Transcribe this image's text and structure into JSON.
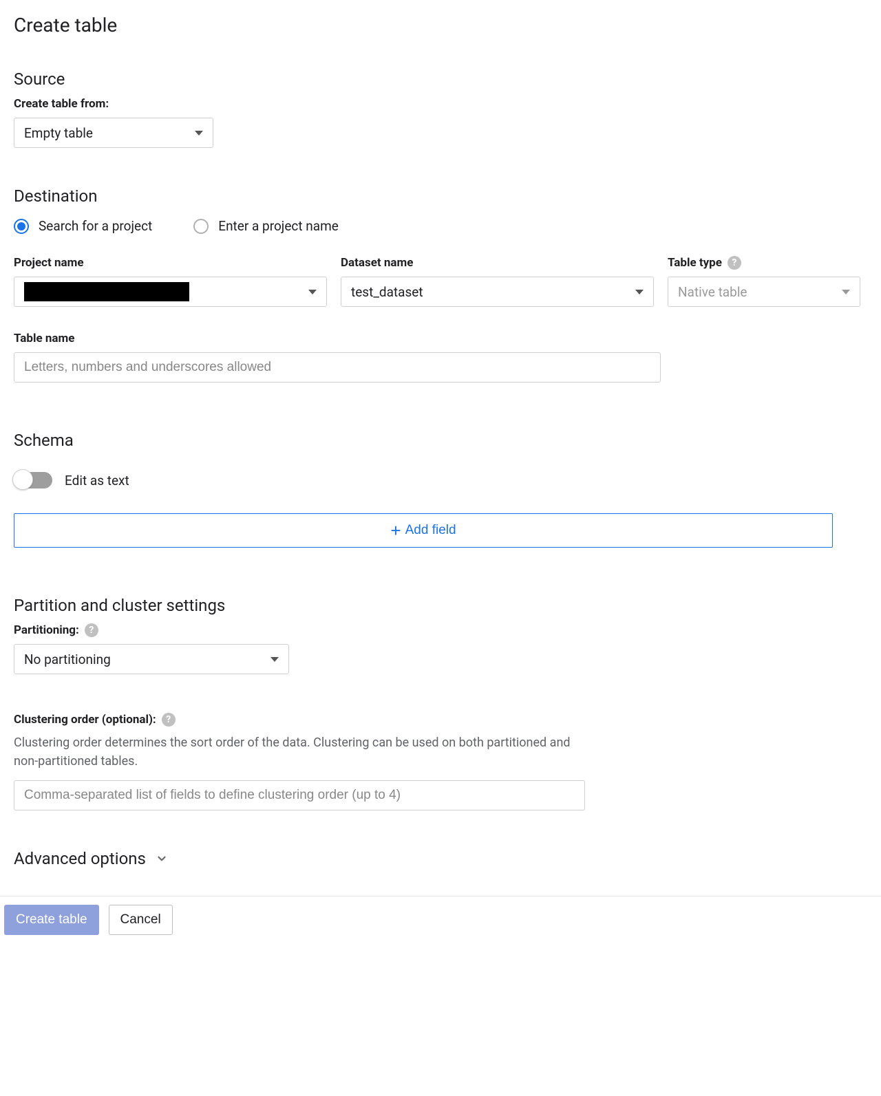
{
  "page_title": "Create table",
  "source": {
    "heading": "Source",
    "create_from_label": "Create table from:",
    "create_from_value": "Empty table"
  },
  "destination": {
    "heading": "Destination",
    "radio_search": "Search for a project",
    "radio_enter": "Enter a project name",
    "project_name_label": "Project name",
    "dataset_name_label": "Dataset name",
    "dataset_name_value": "test_dataset",
    "table_type_label": "Table type",
    "table_type_value": "Native table",
    "table_name_label": "Table name",
    "table_name_placeholder": "Letters, numbers and underscores allowed"
  },
  "schema": {
    "heading": "Schema",
    "edit_as_text": "Edit as text",
    "add_field": "Add field"
  },
  "partition": {
    "heading": "Partition and cluster settings",
    "partitioning_label": "Partitioning:",
    "partitioning_value": "No partitioning",
    "clustering_label": "Clustering order (optional):",
    "clustering_hint": "Clustering order determines the sort order of the data. Clustering can be used on both partitioned and non-partitioned tables.",
    "clustering_placeholder": "Comma-separated list of fields to define clustering order (up to 4)"
  },
  "advanced_label": "Advanced options",
  "footer": {
    "create": "Create table",
    "cancel": "Cancel"
  },
  "icons": {
    "help": "?"
  }
}
